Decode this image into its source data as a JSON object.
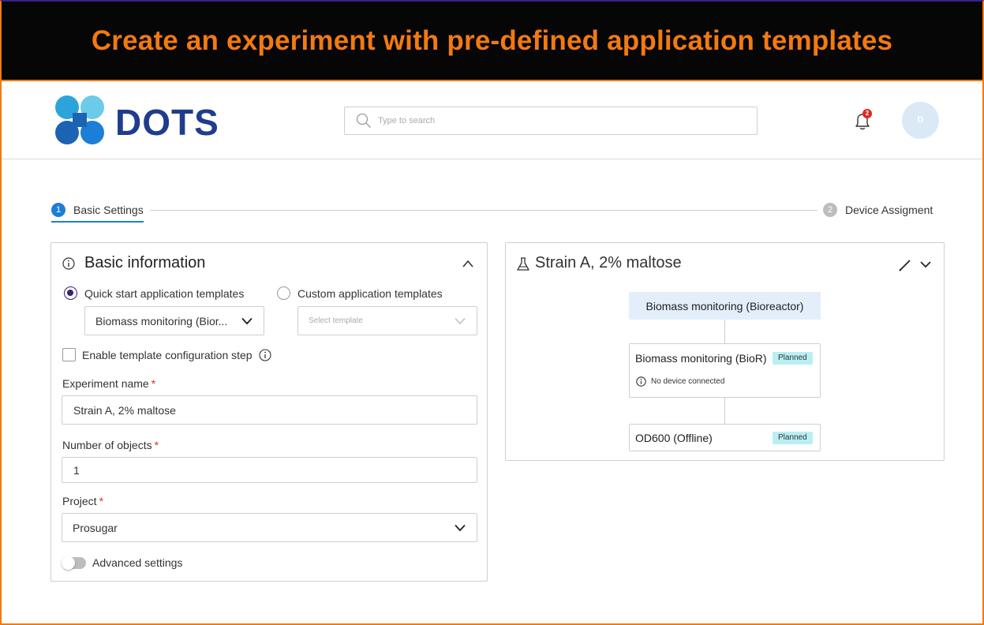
{
  "banner": {
    "title": "Create an experiment with pre-defined application templates"
  },
  "header": {
    "logo_text": "DOTS",
    "search_placeholder": "Type to search",
    "notification_count": "2",
    "avatar_initial": "D"
  },
  "stepper": {
    "steps": [
      {
        "number": "1",
        "label": "Basic Settings",
        "active": true
      },
      {
        "number": "2",
        "label": "Device Assigment",
        "active": false
      }
    ]
  },
  "basic_info": {
    "title": "Basic information",
    "radio_quick": "Quick start application templates",
    "radio_custom": "Custom application templates",
    "quick_template_value": "Biomass monitoring (Bior...",
    "custom_template_placeholder": "Select template",
    "enable_config_label": "Enable template configuration step",
    "experiment_name_label": "Experiment name",
    "experiment_name_value": "Strain A, 2% maltose",
    "objects_label": "Number of objects",
    "objects_value": "1",
    "project_label": "Project",
    "project_value": "Prosugar",
    "required_mark": "*",
    "advanced_label": "Advanced settings"
  },
  "preview": {
    "title": "Strain A, 2% maltose",
    "flow_head": "Biomass monitoring (Bioreactor)",
    "nodes": [
      {
        "title": "Biomass monitoring (BioR)",
        "badge": "Planned",
        "sub": "No device connected"
      },
      {
        "title": "OD600 (Offline)",
        "badge": "Planned"
      }
    ]
  },
  "colors": {
    "banner_text": "#f37a10",
    "accent_blue": "#1d7ed8",
    "radio_checked": "#3b1f7a",
    "badge_bg": "#b9eff3",
    "logo_navy": "#1f3c8e"
  }
}
